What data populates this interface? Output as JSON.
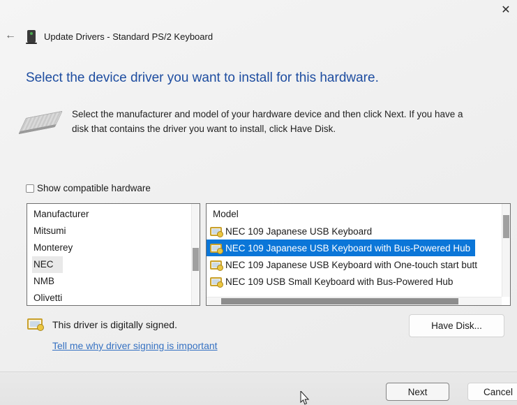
{
  "window": {
    "title": "Update Drivers - Standard PS/2 Keyboard",
    "icons": {
      "close": "✕",
      "back": "←"
    }
  },
  "header": {
    "heading": "Select the device driver you want to install for this hardware.",
    "instructions_line1": "Select the manufacturer and model of your hardware device and then click Next. If you have a",
    "instructions_line2": "disk that contains the driver you want to install, click Have Disk."
  },
  "filter": {
    "checkbox_label": "Show compatible hardware",
    "checked": false
  },
  "manufacturer_list": {
    "header": "Manufacturer",
    "items": [
      {
        "label": "Mitsumi",
        "selected": false
      },
      {
        "label": "Monterey",
        "selected": false
      },
      {
        "label": "NEC",
        "selected": true
      },
      {
        "label": "NMB",
        "selected": false
      },
      {
        "label": "Olivetti",
        "selected": false
      }
    ]
  },
  "model_list": {
    "header": "Model",
    "items": [
      {
        "label": "NEC 109 Japanese USB Keyboard",
        "selected": false
      },
      {
        "label": "NEC 109 Japanese USB Keyboard with Bus-Powered Hub",
        "selected": true
      },
      {
        "label": "NEC 109 Japanese USB Keyboard with One-touch start butt",
        "selected": false
      },
      {
        "label": "NEC 109 USB Small Keyboard with Bus-Powered Hub",
        "selected": false
      }
    ]
  },
  "signing": {
    "signed_text": "This driver is digitally signed.",
    "link_text": "Tell me why driver signing is important"
  },
  "buttons": {
    "have_disk": "Have Disk...",
    "next": "Next",
    "cancel": "Cancel"
  },
  "colors": {
    "accent": "#0b76d8",
    "heading-blue": "#1e4da0",
    "link-blue": "#3571c2"
  }
}
